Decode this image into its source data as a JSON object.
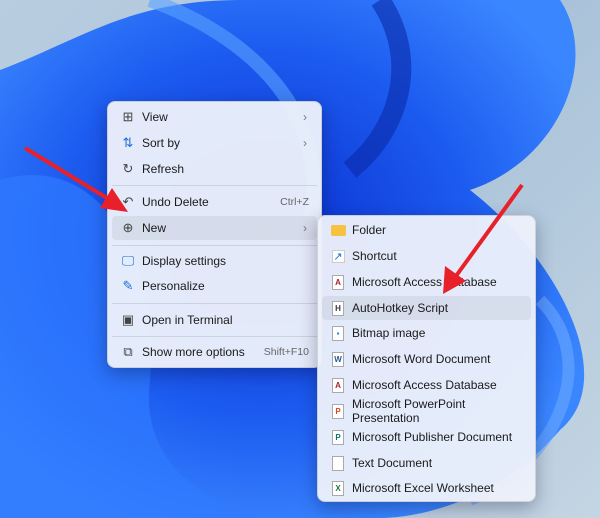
{
  "main_menu": {
    "items": [
      {
        "label": "View",
        "icon": "grid-icon",
        "submenu": true
      },
      {
        "label": "Sort by",
        "icon": "sort-icon",
        "submenu": true
      },
      {
        "label": "Refresh",
        "icon": "refresh-icon"
      },
      {
        "label": "Undo Delete",
        "icon": "undo-icon",
        "shortcut": "Ctrl+Z"
      },
      {
        "label": "New",
        "icon": "plus-circle-icon",
        "submenu": true,
        "highlighted": true
      },
      {
        "label": "Display settings",
        "icon": "display-icon"
      },
      {
        "label": "Personalize",
        "icon": "brush-icon"
      },
      {
        "label": "Open in Terminal",
        "icon": "terminal-icon"
      },
      {
        "label": "Show more options",
        "icon": "more-options-icon",
        "shortcut": "Shift+F10"
      }
    ]
  },
  "new_submenu": {
    "items": [
      {
        "label": "Folder",
        "icon": "folder-icon"
      },
      {
        "label": "Shortcut",
        "icon": "shortcut-icon"
      },
      {
        "label": "Microsoft Access Database",
        "icon": "access-icon"
      },
      {
        "label": "AutoHotkey Script",
        "icon": "autohotkey-icon",
        "highlighted": true
      },
      {
        "label": "Bitmap image",
        "icon": "bitmap-icon"
      },
      {
        "label": "Microsoft Word Document",
        "icon": "word-icon"
      },
      {
        "label": "Microsoft Access Database",
        "icon": "access-icon"
      },
      {
        "label": "Microsoft PowerPoint Presentation",
        "icon": "powerpoint-icon"
      },
      {
        "label": "Microsoft Publisher Document",
        "icon": "publisher-icon"
      },
      {
        "label": "Text Document",
        "icon": "text-document-icon"
      },
      {
        "label": "Microsoft Excel Worksheet",
        "icon": "excel-icon"
      }
    ]
  },
  "colors": {
    "annotation_arrow": "#e8202a",
    "accent": "#1a6fd6"
  }
}
